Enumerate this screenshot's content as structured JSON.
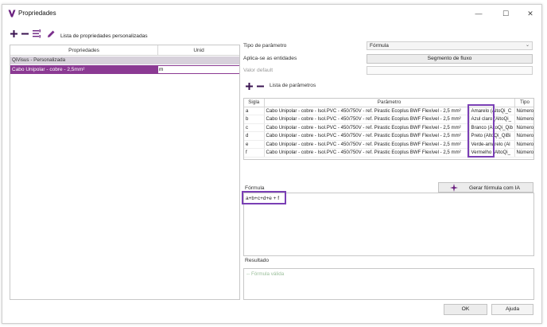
{
  "window": {
    "title": "Propriedades",
    "controls": {
      "minimize": "—",
      "maximize": "☐",
      "close": "✕"
    }
  },
  "toolbar": {
    "custom_list_label": "Lista de propriedades personalizadas",
    "icons": [
      "add-icon",
      "remove-icon",
      "list-icon",
      "edit-icon"
    ]
  },
  "left_panel": {
    "columns": [
      "Propriedades",
      "Unid"
    ],
    "group": "QiVisus - Personalizada",
    "selected_item": {
      "name": "Cabo Unipolar - cobre - 2,5mm²",
      "unit": "m"
    }
  },
  "settings": {
    "param_type_label": "Tipo de parâmetro",
    "param_type_value": "Fórmula",
    "applies_to_label": "Aplica-se as entidades",
    "applies_to_button": "Segmento de fluxo",
    "default_value_label": "Valor default",
    "default_value": ""
  },
  "params": {
    "list_label": "Lista de parâmetros",
    "columns": [
      "Sigla",
      "Parâmetro",
      "Tipo"
    ],
    "rows": [
      {
        "sigla": "a",
        "param": "Cabo Unipolar - cobre - Isol.PVC - 450/750V - ref. Pirastic Ecoplus BWF Flexível - 2,5 mm²",
        "color": "Amarelo (AltoQi_C",
        "tipo": "Número"
      },
      {
        "sigla": "b",
        "param": "Cabo Unipolar - cobre - Isol.PVC - 450/750V - ref. Pirastic Ecoplus BWF Flexível - 2,5 mm²",
        "color": "Azul claro (AltoQi_",
        "tipo": "Número"
      },
      {
        "sigla": "c",
        "param": "Cabo Unipolar - cobre - Isol.PVC - 450/750V - ref. Pirastic Ecoplus BWF Flexível - 2,5 mm²",
        "color": "Branco (AltoQi_Qib",
        "tipo": "Número"
      },
      {
        "sigla": "d",
        "param": "Cabo Unipolar - cobre - Isol.PVC - 450/750V - ref. Pirastic Ecoplus BWF Flexível - 2,5 mm²",
        "color": "Preto (AltoQi_QiBi",
        "tipo": "Número"
      },
      {
        "sigla": "e",
        "param": "Cabo Unipolar - cobre - Isol.PVC - 450/750V - ref. Pirastic Ecoplus BWF Flexível - 2,5 mm²",
        "color": "Verde-amarelo (Al",
        "tipo": "Número"
      },
      {
        "sigla": "f",
        "param": "Cabo Unipolar - cobre - Isol.PVC - 450/750V - ref. Pirastic Ecoplus BWF Flexível - 2,5 mm²",
        "color": "Vermelho (AltoQi_",
        "tipo": "Número"
      }
    ]
  },
  "formula": {
    "label": "Fórmula",
    "ai_button": "Gerar fórmula com IA",
    "expression": "a+b+c+d+e + f"
  },
  "result": {
    "label": "Resultado",
    "status": "-- Fórmula válida"
  },
  "footer": {
    "ok": "OK",
    "help": "Ajuda"
  },
  "colors": {
    "accent": "#8b3a93",
    "highlight": "#7a3fb5",
    "group_bg": "#d7d1db"
  }
}
